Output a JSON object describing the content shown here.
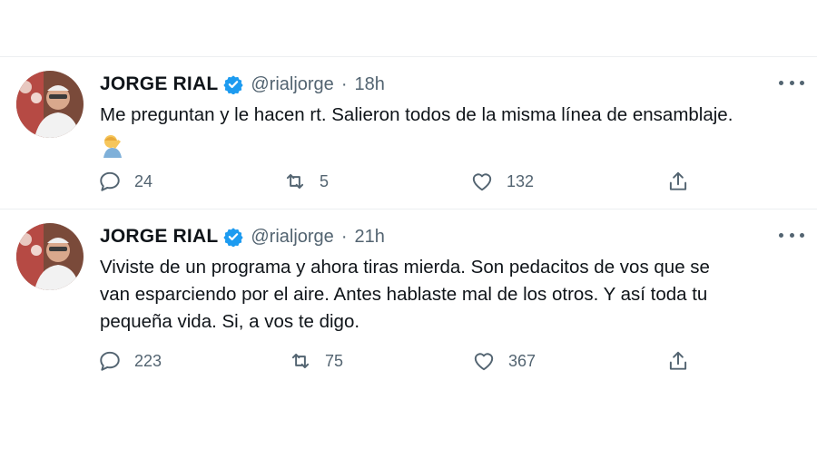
{
  "tweets": [
    {
      "name": "JORGE RIAL",
      "handle": "@rialjorge",
      "separator": "·",
      "time": "18h",
      "text": "Me preguntan y le hacen rt. Salieron todos de la misma línea de ensamblaje.",
      "emoji": "person-facepalming-icon",
      "replies": "24",
      "retweets": "5",
      "likes": "132"
    },
    {
      "name": "JORGE RIAL",
      "handle": "@rialjorge",
      "separator": "·",
      "time": "21h",
      "text": "Viviste de un programa y ahora tiras mierda. Son pedacitos de vos que se\nvan esparciendo por el aire. Antes hablaste mal de los otros. Y así toda tu\npequeña vida. Si, a vos te digo.",
      "replies": "223",
      "retweets": "75",
      "likes": "367"
    }
  ],
  "colors": {
    "accent": "#1d9bf0",
    "secondary_text": "#536471",
    "divider": "#eceff1"
  }
}
